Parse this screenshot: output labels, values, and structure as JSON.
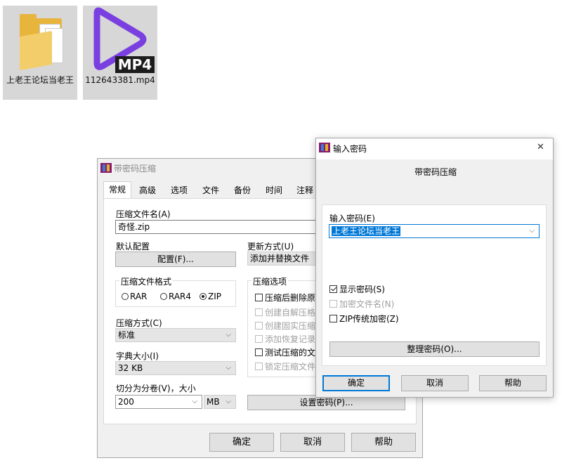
{
  "desktop": {
    "folder_label": "上老王论坛当老王",
    "video_label": "112643381.mp4",
    "video_badge": "MP4"
  },
  "main_dialog": {
    "title": "带密码压缩",
    "tabs": [
      "常规",
      "高级",
      "选项",
      "文件",
      "备份",
      "时间",
      "注释"
    ],
    "archive_name_label": "压缩文件名(A)",
    "archive_name_value": "奇怪.zip",
    "profile_label": "默认配置",
    "profile_button": "配置(F)...",
    "update_mode_label": "更新方式(U)",
    "update_mode_value": "添加并替换文件",
    "format_group": "压缩文件格式",
    "formats": [
      "RAR",
      "RAR4",
      "ZIP"
    ],
    "selected_format": "ZIP",
    "method_label": "压缩方式(C)",
    "method_value": "标准",
    "dict_label": "字典大小(I)",
    "dict_value": "32 KB",
    "split_label": "切分为分卷(V)，大小",
    "split_value": "200",
    "split_unit": "MB",
    "options_group": "压缩选项",
    "options": [
      {
        "label": "压缩后删除原来",
        "enabled": true,
        "checked": false
      },
      {
        "label": "创建自解压格式",
        "enabled": false,
        "checked": false
      },
      {
        "label": "创建固实压缩文",
        "enabled": false,
        "checked": false
      },
      {
        "label": "添加恢复记录(E",
        "enabled": false,
        "checked": false
      },
      {
        "label": "测试压缩的文件",
        "enabled": true,
        "checked": false
      },
      {
        "label": "锁定压缩文件(L",
        "enabled": false,
        "checked": false
      }
    ],
    "set_password_button": "设置密码(P)...",
    "ok_button": "确定",
    "cancel_button": "取消",
    "help_button": "帮助"
  },
  "password_dialog": {
    "title": "输入密码",
    "heading": "带密码压缩",
    "close_glyph": "✕",
    "password_label": "输入密码(E)",
    "password_value": "上老王论坛当老王",
    "show_password": "显示密码(S)",
    "encrypt_names": "加密文件名(N)",
    "zip_legacy": "ZIP传统加密(Z)",
    "organize_button": "整理密码(O)...",
    "ok_button": "确定",
    "cancel_button": "取消",
    "help_button": "帮助"
  }
}
